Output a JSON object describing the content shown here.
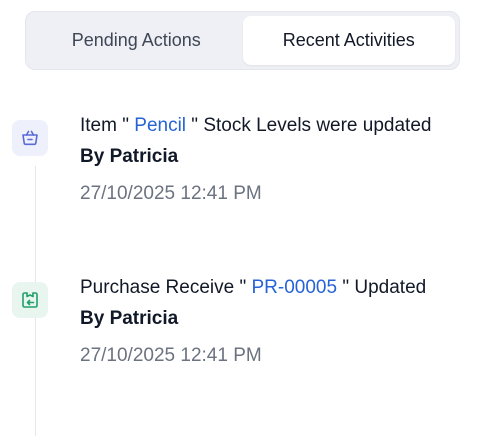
{
  "tabs": {
    "pending_label": "Pending Actions",
    "recent_label": "Recent Activities"
  },
  "activities": [
    {
      "icon": "basket-icon",
      "icon_color": "#5b6bd6",
      "prefix": "Item \" ",
      "link": "Pencil",
      "suffix": " \" Stock Levels were updated",
      "by": "By Patricia",
      "timestamp": "27/10/2025 12:41 PM"
    },
    {
      "icon": "receive-icon",
      "icon_color": "#22a06b",
      "prefix": "Purchase Receive \" ",
      "link": "PR-00005",
      "suffix": " \" Updated",
      "by": "By Patricia",
      "timestamp": "27/10/2025 12:41 PM"
    }
  ],
  "colors": {
    "link": "#2563d6",
    "timestamp": "#6b7280",
    "tab_bg": "#eef0f5"
  }
}
